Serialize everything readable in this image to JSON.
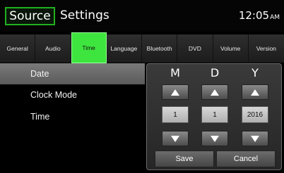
{
  "header": {
    "source_label": "Source",
    "title": "Settings",
    "clock_time": "12:05",
    "clock_suffix": "AM"
  },
  "tabs": [
    {
      "label": "General"
    },
    {
      "label": "Audio"
    },
    {
      "label": "Time",
      "active": true
    },
    {
      "label": "Language"
    },
    {
      "label": "Bluetooth"
    },
    {
      "label": "DVD"
    },
    {
      "label": "Volume"
    },
    {
      "label": "Version"
    }
  ],
  "settings_list": [
    {
      "label": "Date",
      "selected": true
    },
    {
      "label": "Clock Mode"
    },
    {
      "label": "Time"
    }
  ],
  "date_picker": {
    "columns": [
      {
        "header": "M",
        "value": "1"
      },
      {
        "header": "D",
        "value": "1"
      },
      {
        "header": "Y",
        "value": "2016"
      }
    ],
    "save_label": "Save",
    "cancel_label": "Cancel"
  },
  "colors": {
    "accent_green": "#3ee53e",
    "source_border": "#1fb21f",
    "selected_row": "#6a6a6a"
  },
  "icons": {
    "increment": "triangle-up-icon",
    "decrement": "triangle-down-icon"
  }
}
